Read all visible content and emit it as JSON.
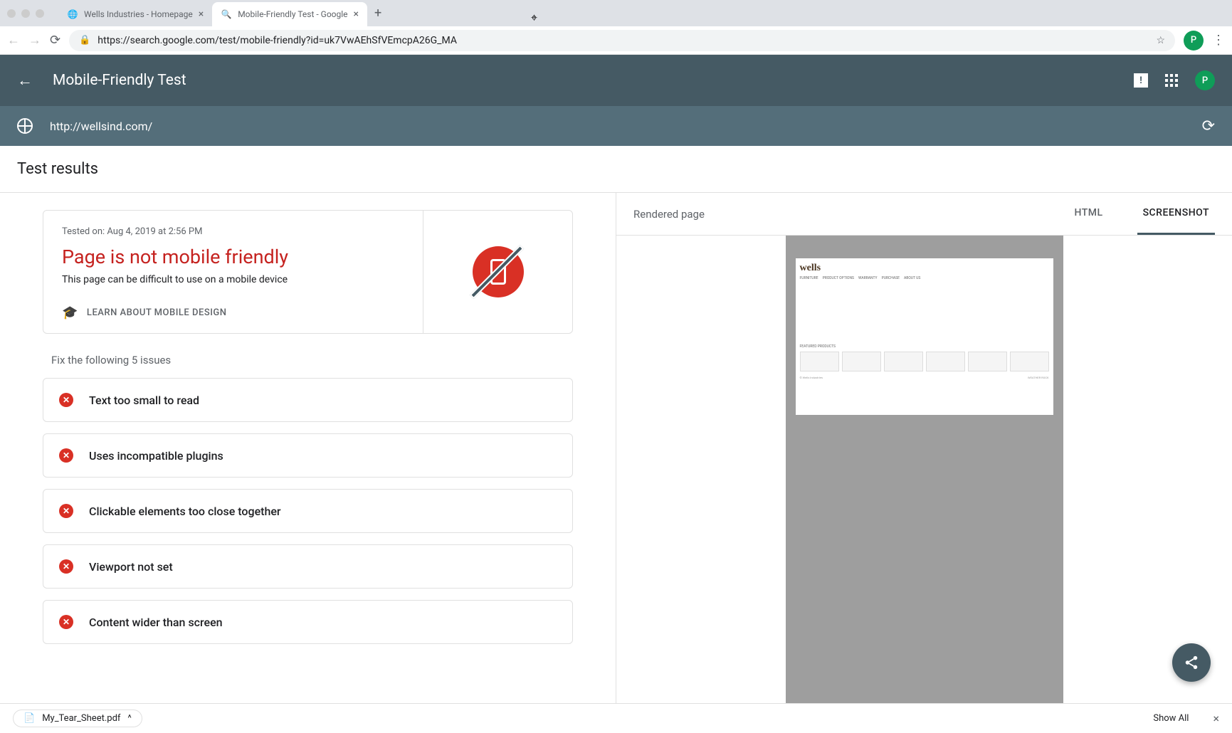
{
  "browser": {
    "tabs": [
      {
        "title": "Wells Industries - Homepage",
        "active": false
      },
      {
        "title": "Mobile-Friendly Test - Google",
        "active": true
      }
    ],
    "url_display": "https://search.google.com/test/mobile-friendly?id=uk7VwAEhSfVEmcpA26G_MA",
    "profile_letter": "P"
  },
  "app": {
    "title": "Mobile-Friendly Test",
    "tested_url": "http://wellsind.com/",
    "profile_letter": "P"
  },
  "section_heading": "Test results",
  "result": {
    "tested_on": "Tested on: Aug 4, 2019 at 2:56 PM",
    "title": "Page is not mobile friendly",
    "subtitle": "This page can be difficult to use on a mobile device",
    "learn_link": "LEARN ABOUT MOBILE DESIGN"
  },
  "fix_heading": "Fix the following 5 issues",
  "issues": [
    {
      "text": "Text too small to read"
    },
    {
      "text": "Uses incompatible plugins"
    },
    {
      "text": "Clickable elements too close together"
    },
    {
      "text": "Viewport not set"
    },
    {
      "text": "Content wider than screen"
    }
  ],
  "right": {
    "rendered_label": "Rendered page",
    "tabs": [
      {
        "label": "HTML",
        "active": false
      },
      {
        "label": "SCREENSHOT",
        "active": true
      }
    ]
  },
  "preview_site": {
    "logo": "wells",
    "nav": [
      "FURNITURE",
      "PRODUCT OPTIONS",
      "WARRANTY",
      "PURCHASE",
      "ABOUT US"
    ],
    "featured_label": "FEATURED PRODUCTS",
    "footer_brand": "WEATHER ROCK"
  },
  "download": {
    "filename": "My_Tear_Sheet.pdf",
    "show_all": "Show All"
  }
}
